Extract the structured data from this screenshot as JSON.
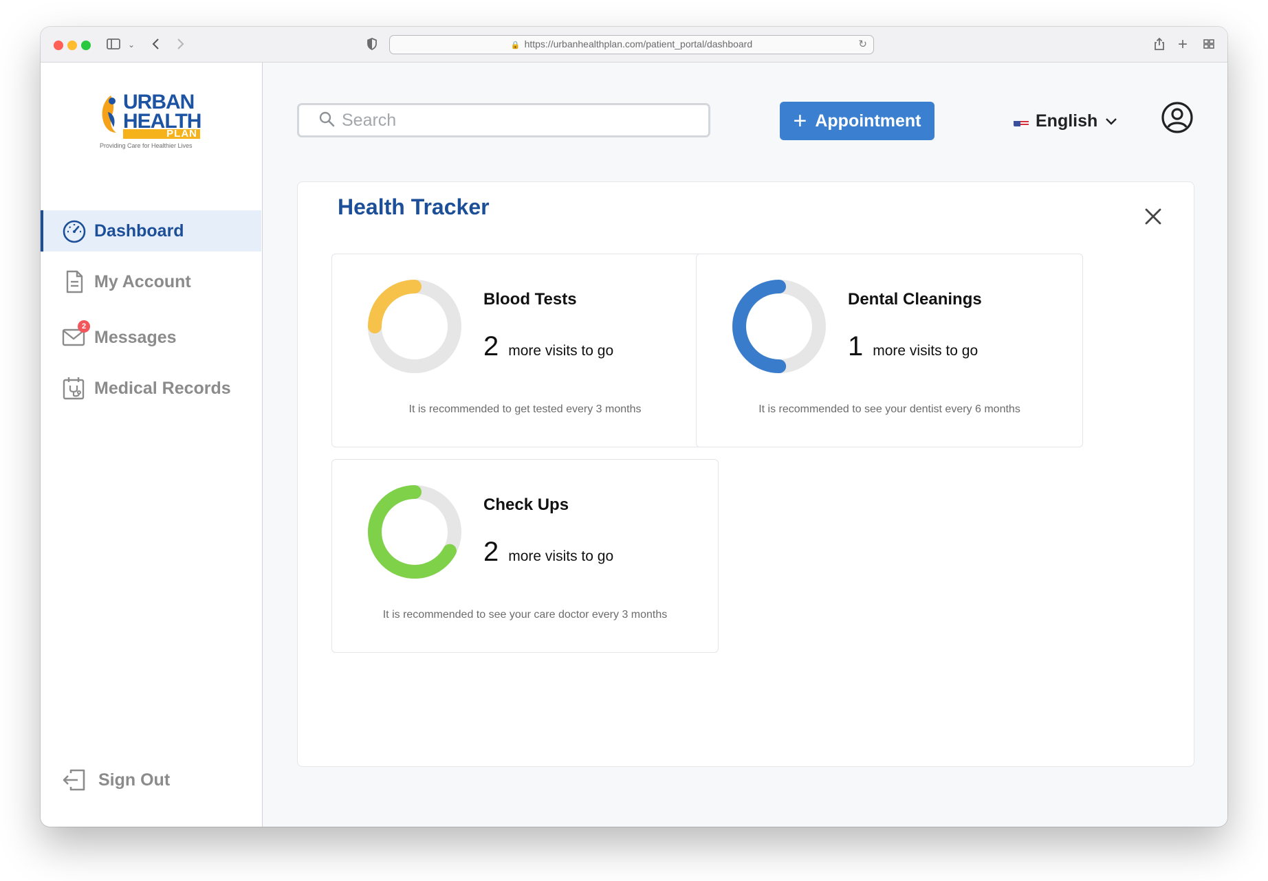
{
  "browser": {
    "url": "https://urbanhealthplan.com/patient_portal/dashboard"
  },
  "logo": {
    "line1": "URBAN",
    "line2": "HEALTH",
    "line3": "PLAN",
    "tagline": "Providing Care for Healthier Lives"
  },
  "sidebar": {
    "items": [
      {
        "label": "Dashboard",
        "icon": "dashboard-gauge-icon",
        "active": true
      },
      {
        "label": "My Account",
        "icon": "document-icon",
        "active": false
      },
      {
        "label": "Messages",
        "icon": "mail-icon",
        "active": false,
        "badge": "2"
      },
      {
        "label": "Medical Records",
        "icon": "calendar-stethoscope-icon",
        "active": false
      }
    ],
    "sign_out": "Sign Out"
  },
  "header": {
    "search_placeholder": "Search",
    "appointment_label": "Appointment",
    "language": "English"
  },
  "tracker": {
    "title": "Health Tracker",
    "cards": [
      {
        "title": "Blood Tests",
        "remaining": "2",
        "suffix": "more visits to go",
        "note": "It is recommended to get tested every 3 months",
        "progress": 0.25,
        "color": "#f6c24a"
      },
      {
        "title": "Dental Cleanings",
        "remaining": "1",
        "suffix": "more visits to go",
        "note": "It is recommended to see your dentist every 6 months",
        "progress": 0.5,
        "color": "#3a7ccc"
      },
      {
        "title": "Check Ups",
        "remaining": "2",
        "suffix": "more visits to go",
        "note": "It is recommended to see your care doctor every 3 months",
        "progress": 0.67,
        "color": "#7fd14a"
      }
    ]
  },
  "colors": {
    "brand_blue": "#1d4f98",
    "button_blue": "#3b7fd0",
    "track_gray": "#e6e6e6"
  }
}
